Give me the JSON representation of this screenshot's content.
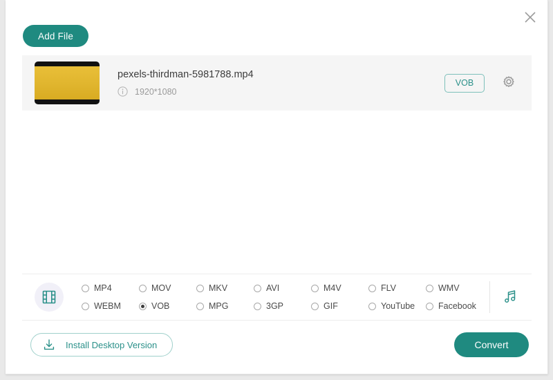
{
  "window": {
    "close_label": "×"
  },
  "toolbar": {
    "add_file_label": "Add File"
  },
  "files": [
    {
      "name": "pexels-thirdman-5981788.mp4",
      "resolution": "1920*1080",
      "output_format": "VOB"
    }
  ],
  "format_bar": {
    "video_icon": "film-strip-icon",
    "audio_icon": "music-note-icon",
    "selected": "VOB",
    "options": [
      "MP4",
      "MOV",
      "MKV",
      "AVI",
      "M4V",
      "FLV",
      "WEBM",
      "VOB",
      "MPG",
      "3GP",
      "GIF",
      "YouTube"
    ],
    "extra_options": [
      "WMV",
      "Facebook"
    ],
    "row1": [
      "MP4",
      "MOV",
      "MKV",
      "AVI",
      "M4V",
      "FLV",
      "WMV"
    ],
    "row2": [
      "WEBM",
      "VOB",
      "MPG",
      "3GP",
      "GIF",
      "YouTube",
      "Facebook"
    ]
  },
  "footer": {
    "install_label": "Install Desktop Version",
    "convert_label": "Convert"
  },
  "colors": {
    "accent": "#1f8a80",
    "accent_light": "#2a9089",
    "row_bg": "#f5f5f5",
    "thumb_gold": "#e0b52e"
  }
}
